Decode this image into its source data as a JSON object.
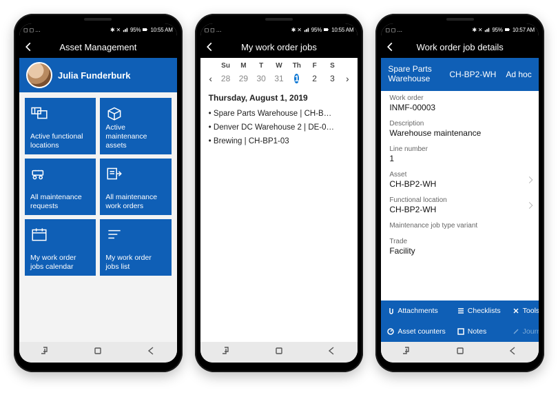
{
  "status": {
    "time1": "10:55 AM",
    "time2": "10:55 AM",
    "time3": "10:57 AM",
    "battery": "95%"
  },
  "topbar": {
    "title1": "Asset Management",
    "title2": "My work order jobs",
    "title3": "Work order job details"
  },
  "user": {
    "name": "Julia Funderburk"
  },
  "tiles": [
    {
      "id": "active-functional-locations",
      "label": "Active functional locations"
    },
    {
      "id": "active-maintenance-assets",
      "label": "Active maintenance assets"
    },
    {
      "id": "all-maintenance-requests",
      "label": "All maintenance requests"
    },
    {
      "id": "all-maintenance-work-orders",
      "label": "All maintenance work orders"
    },
    {
      "id": "my-work-order-jobs-calendar",
      "label": "My work order jobs calendar"
    },
    {
      "id": "my-work-order-jobs-list",
      "label": "My work order jobs list"
    }
  ],
  "calendar": {
    "dow": [
      "Su",
      "M",
      "T",
      "W",
      "Th",
      "F",
      "S"
    ],
    "dates": [
      "28",
      "29",
      "30",
      "31",
      "1",
      "2",
      "3"
    ],
    "selectedIndex": 4,
    "title": "Thursday, August 1, 2019",
    "items": [
      "Spare Parts Warehouse | CH-B…",
      "Denver DC Warehouse 2 | DE-0…",
      "Brewing | CH-BP1-03"
    ]
  },
  "detail": {
    "tabs": [
      "Spare Parts Warehouse",
      "CH-BP2-WH",
      "Ad hoc"
    ],
    "fields": [
      {
        "label": "Work order",
        "value": "INMF-00003"
      },
      {
        "label": "Description",
        "value": "Warehouse maintenance"
      },
      {
        "label": "Line number",
        "value": "1"
      },
      {
        "label": "Asset",
        "value": "CH-BP2-WH",
        "nav": true
      },
      {
        "label": "Functional location",
        "value": "CH-BP2-WH",
        "nav": true
      },
      {
        "label": "Maintenance job type variant",
        "value": ""
      },
      {
        "label": "Trade",
        "value": "Facility"
      }
    ],
    "actions": [
      "Attachments",
      "Checklists",
      "Tools",
      "Asset counters",
      "Notes",
      "Journal"
    ]
  }
}
